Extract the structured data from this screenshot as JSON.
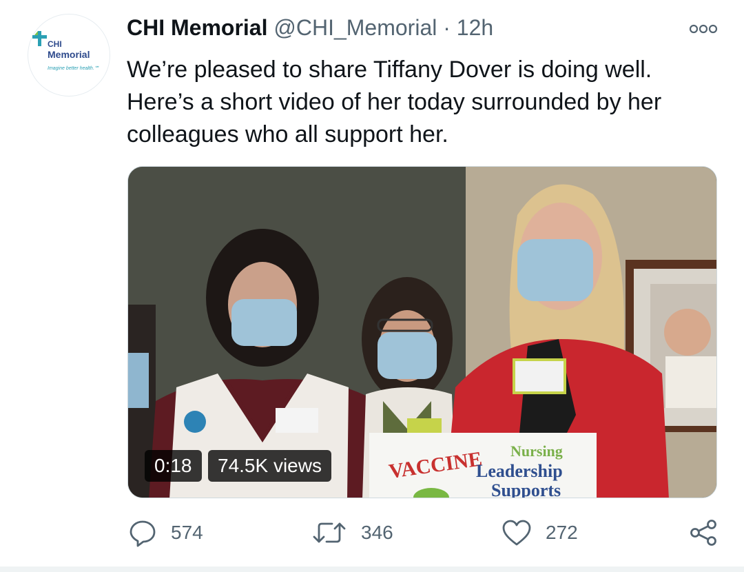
{
  "account": {
    "name": "CHI Memorial",
    "handle": "@CHI_Memorial",
    "separator": "·",
    "time": "12h",
    "avatar": {
      "logo_line1": "CHI",
      "logo_line2": "Memorial",
      "tagline": "Imagine better health.℠"
    }
  },
  "tweet": {
    "text": "We’re pleased to share Tiffany Dover is doing well. Here’s a short video of her today surrounded by her colleagues who all support her."
  },
  "media": {
    "duration": "0:18",
    "views": "74.5K views",
    "sign_text": {
      "vaccine": "VACCINE",
      "nursing": "Nursing",
      "leadership": "Leadership",
      "supports": "Supports"
    }
  },
  "actions": {
    "reply_count": "574",
    "retweet_count": "346",
    "like_count": "272"
  },
  "icons": {
    "more": "more-icon",
    "reply": "reply-icon",
    "retweet": "retweet-icon",
    "like": "heart-icon",
    "share": "share-icon"
  },
  "colors": {
    "text_primary": "#0f1419",
    "text_secondary": "#536471",
    "brand_blue": "#2e4a8c",
    "brand_teal": "#2ba0b4"
  }
}
